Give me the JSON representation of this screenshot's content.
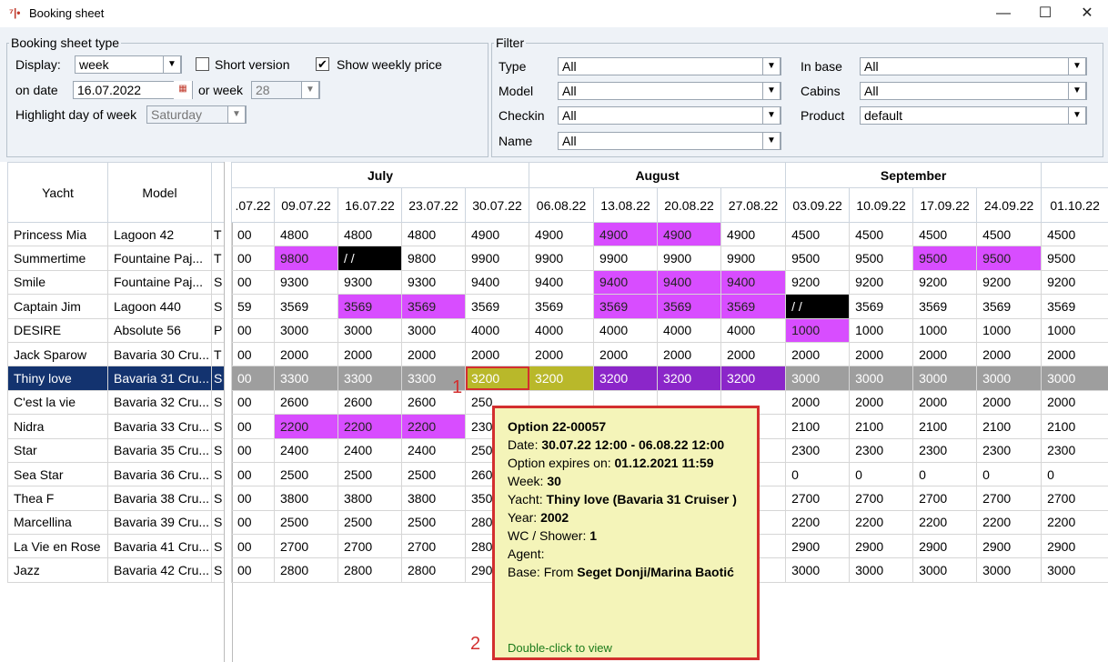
{
  "window": {
    "title": "Booking sheet",
    "icon_text": "⁷|•",
    "minimize": "—",
    "maximize": "☐",
    "close": "✕"
  },
  "booking_type": {
    "legend": "Booking sheet type",
    "display_label": "Display:",
    "display_value": "week",
    "short_version_label": "Short version",
    "short_version_checked": false,
    "show_weekly_label": "Show weekly price",
    "show_weekly_checked": true,
    "on_date_label": "on date",
    "on_date_value": "16.07.2022",
    "or_week_label": "or week",
    "week_value": "28",
    "highlight_label": "Highlight day of week",
    "highlight_value": "Saturday"
  },
  "filter": {
    "legend": "Filter",
    "type_label": "Type",
    "type_value": "All",
    "model_label": "Model",
    "model_value": "All",
    "checkin_label": "Checkin",
    "checkin_value": "All",
    "name_label": "Name",
    "name_value": "All",
    "inbase_label": "In base",
    "inbase_value": "All",
    "cabins_label": "Cabins",
    "cabins_value": "All",
    "product_label": "Product",
    "product_value": "default"
  },
  "grid": {
    "yacht_header": "Yacht",
    "model_header": "Model",
    "months": [
      "July",
      "August",
      "September"
    ],
    "weeks": [
      ".07.22",
      "09.07.22",
      "16.07.22",
      "23.07.22",
      "30.07.22",
      "06.08.22",
      "13.08.22",
      "20.08.22",
      "27.08.22",
      "03.09.22",
      "10.09.22",
      "17.09.22",
      "24.09.22",
      "01.10.22"
    ],
    "rows": [
      {
        "yacht": "Princess Mia",
        "model": "Lagoon 42",
        "t": "T",
        "prices": [
          "00",
          "4800",
          "4800",
          "4800",
          "4900",
          "4900",
          "4900",
          "4900",
          "4900",
          "4500",
          "4500",
          "4500",
          "4500",
          "4500"
        ]
      },
      {
        "yacht": "Summertime",
        "model": "Fountaine Paj...",
        "t": "T",
        "prices": [
          "00",
          "9800",
          "/ /",
          "9800",
          "9900",
          "9900",
          "9900",
          "9900",
          "9900",
          "9500",
          "9500",
          "9500",
          "9500",
          "9500"
        ]
      },
      {
        "yacht": "Smile",
        "model": "Fountaine Paj...",
        "t": "S",
        "prices": [
          "00",
          "9300",
          "9300",
          "9300",
          "9400",
          "9400",
          "9400",
          "9400",
          "9400",
          "9200",
          "9200",
          "9200",
          "9200",
          "9200"
        ]
      },
      {
        "yacht": "Captain Jim",
        "model": "Lagoon 440",
        "t": "S",
        "prices": [
          "59",
          "3569",
          "3569",
          "3569",
          "3569",
          "3569",
          "3569",
          "3569",
          "3569",
          "/ /",
          "3569",
          "3569",
          "3569",
          "3569"
        ]
      },
      {
        "yacht": "DESIRE",
        "model": "Absolute 56",
        "t": "P",
        "prices": [
          "00",
          "3000",
          "3000",
          "3000",
          "4000",
          "4000",
          "4000",
          "4000",
          "4000",
          "1000",
          "1000",
          "1000",
          "1000",
          "1000"
        ]
      },
      {
        "yacht": "Jack Sparow",
        "model": "Bavaria 30 Cru...",
        "t": "T",
        "prices": [
          "00",
          "2000",
          "2000",
          "2000",
          "2000",
          "2000",
          "2000",
          "2000",
          "2000",
          "2000",
          "2000",
          "2000",
          "2000",
          "2000"
        ]
      },
      {
        "yacht": "Thiny love",
        "model": "Bavaria 31 Cru...",
        "t": "S",
        "prices": [
          "00",
          "3300",
          "3300",
          "3300",
          "3200",
          "3200",
          "3200",
          "3200",
          "3200",
          "3000",
          "3000",
          "3000",
          "3000",
          "3000"
        ]
      },
      {
        "yacht": "C'est la vie",
        "model": "Bavaria 32 Cru...",
        "t": "S",
        "prices": [
          "00",
          "2600",
          "2600",
          "2600",
          "250",
          "",
          "",
          "",
          "",
          "2000",
          "2000",
          "2000",
          "2000",
          "2000"
        ]
      },
      {
        "yacht": "Nidra",
        "model": "Bavaria 33 Cru...",
        "t": "S",
        "prices": [
          "00",
          "2200",
          "2200",
          "2200",
          "230",
          "",
          "",
          "",
          "",
          "2100",
          "2100",
          "2100",
          "2100",
          "2100"
        ]
      },
      {
        "yacht": "Star",
        "model": "Bavaria 35 Cru...",
        "t": "S",
        "prices": [
          "00",
          "2400",
          "2400",
          "2400",
          "250",
          "",
          "",
          "",
          "",
          "2300",
          "2300",
          "2300",
          "2300",
          "2300"
        ]
      },
      {
        "yacht": "Sea Star",
        "model": "Bavaria 36 Cru...",
        "t": "S",
        "prices": [
          "00",
          "2500",
          "2500",
          "2500",
          "260",
          "",
          "",
          "",
          "",
          "0",
          "0",
          "0",
          "0",
          "0"
        ]
      },
      {
        "yacht": "Thea F",
        "model": "Bavaria 38 Cru...",
        "t": "S",
        "prices": [
          "00",
          "3800",
          "3800",
          "3800",
          "350",
          "",
          "",
          "",
          "",
          "2700",
          "2700",
          "2700",
          "2700",
          "2700"
        ]
      },
      {
        "yacht": "Marcellina",
        "model": "Bavaria 39 Cru...",
        "t": "S",
        "prices": [
          "00",
          "2500",
          "2500",
          "2500",
          "280",
          "",
          "",
          "",
          "",
          "2200",
          "2200",
          "2200",
          "2200",
          "2200"
        ]
      },
      {
        "yacht": "La Vie en Rose",
        "model": "Bavaria 41 Cru...",
        "t": "S",
        "prices": [
          "00",
          "2700",
          "2700",
          "2700",
          "280",
          "",
          "",
          "",
          "",
          "2900",
          "2900",
          "2900",
          "2900",
          "2900"
        ]
      },
      {
        "yacht": "Jazz",
        "model": "Bavaria 42 Cru...",
        "t": "S",
        "prices": [
          "00",
          "2800",
          "2800",
          "2800",
          "290",
          "",
          "",
          "",
          "",
          "3000",
          "3000",
          "3000",
          "3000",
          "3000"
        ]
      }
    ]
  },
  "tooltip": {
    "title": "Option 22-00057",
    "date_label": "Date: ",
    "date_value": "30.07.22 12:00 - 06.08.22 12:00",
    "expires_label": "Option expires on: ",
    "expires_value": "01.12.2021 11:59",
    "week_label": "Week: ",
    "week_value": "30",
    "yacht_label": "Yacht: ",
    "yacht_value": "Thiny love (Bavaria 31 Cruiser )",
    "year_label": "Year: ",
    "year_value": "2002",
    "wc_label": "WC / Shower: ",
    "wc_value": "1",
    "agent_label": "Agent:",
    "base_label": "Base: From ",
    "base_value": "Seget Donji/Marina Baotić",
    "footer": "Double-click to view"
  },
  "annotations": {
    "one": "1",
    "two": "2"
  }
}
